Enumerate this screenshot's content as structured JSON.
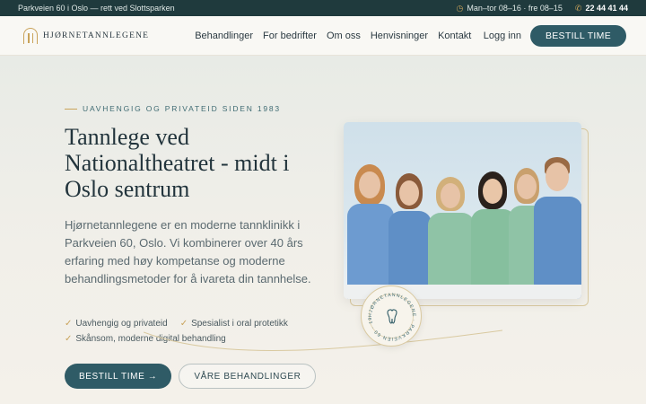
{
  "topbar": {
    "address": "Parkveien 60 i Oslo — rett ved Slottsparken",
    "hours_icon": "clock-icon",
    "hours": "Man–tor 08–16 · fre 08–15",
    "phone_icon": "phone-icon",
    "phone": "22 44 41 44"
  },
  "nav": {
    "logo_text": "HJØRNETANNLEGENE",
    "menu": [
      "Behandlinger",
      "For bedrifter",
      "Om oss",
      "Henvisninger",
      "Kontakt"
    ],
    "login": "Logg inn",
    "book": "BESTILL TIME"
  },
  "hero": {
    "eyebrow": "UAVHENGIG OG PRIVATEID SIDEN 1983",
    "title": "Tannlege ved Nationaltheatret - midt i Oslo sentrum",
    "lead": "Hjørnetannlegene er en moderne tannklinikk i Parkveien 60, Oslo. Vi kombinerer over 40 års erfaring med høy kompetanse og moderne behandlingsmetoder for å ivareta din tannhelse.",
    "checks": [
      "Uavhengig og privateid",
      "Spesialist i oral protetikk",
      "Skånsom, moderne digital behandling"
    ],
    "cta_primary": "BESTILL TIME →",
    "cta_secondary": "VÅRE BEHANDLINGER"
  },
  "badge": {
    "ring_text": "HJØRNETANNLEGENE · PARKVEIEN 60 · 1983 ·",
    "icon": "tooth-icon"
  },
  "colors": {
    "primary": "#2f5b66",
    "dark": "#1f3a3d",
    "gold": "#c9a35a",
    "scrubs_blue": "#6d9bd0",
    "scrubs_green": "#8fc3a6"
  }
}
